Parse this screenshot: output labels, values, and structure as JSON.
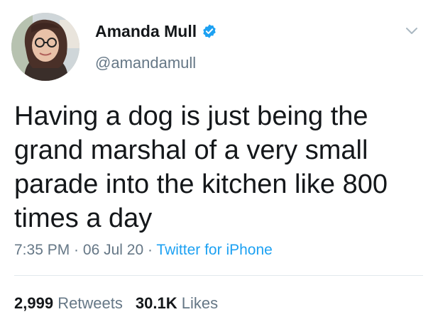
{
  "author": {
    "display_name": "Amanda Mull",
    "handle": "@amandamull",
    "verified": true
  },
  "tweet": {
    "text": "Having a dog is just being the\ngrand marshal of a very small\nparade into the kitchen like 800\ntimes a day",
    "time": "7:35 PM",
    "separator": " · ",
    "date": "06 Jul 20",
    "source": "Twitter for iPhone"
  },
  "stats": {
    "retweets_count": "2,999",
    "retweets_label": "Retweets",
    "likes_count": "30.1K",
    "likes_label": "Likes"
  },
  "icons": {
    "verified": "verified-badge-icon",
    "menu": "chevron-down-icon"
  },
  "colors": {
    "accent": "#1da1f2",
    "secondary_text": "#657786",
    "primary_text": "#14171a",
    "divider": "#e1e8ed"
  }
}
